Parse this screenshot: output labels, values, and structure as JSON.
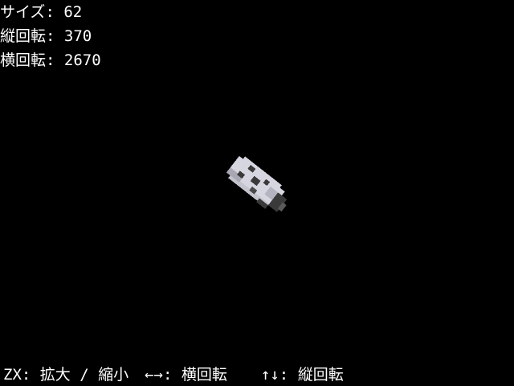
{
  "status": {
    "size_label": "サイズ",
    "size_value": "62",
    "vertical_rotation_label": "縦回転",
    "vertical_rotation_value": "370",
    "horizontal_rotation_label": "横回転",
    "horizontal_rotation_value": "2670",
    "separator": ": "
  },
  "controls": {
    "zoom_keys": "ZX",
    "zoom_action": "拡大 / 縮小",
    "horizontal_keys": "←→",
    "horizontal_action": "横回転",
    "vertical_keys": "↑↓",
    "vertical_action": "縦回転",
    "separator": ": "
  },
  "colors": {
    "background": "#000000",
    "text": "#ffffff",
    "model_light": "#d6d6e0",
    "model_mid": "#9a9aa6",
    "model_dark": "#3a3a3a"
  }
}
